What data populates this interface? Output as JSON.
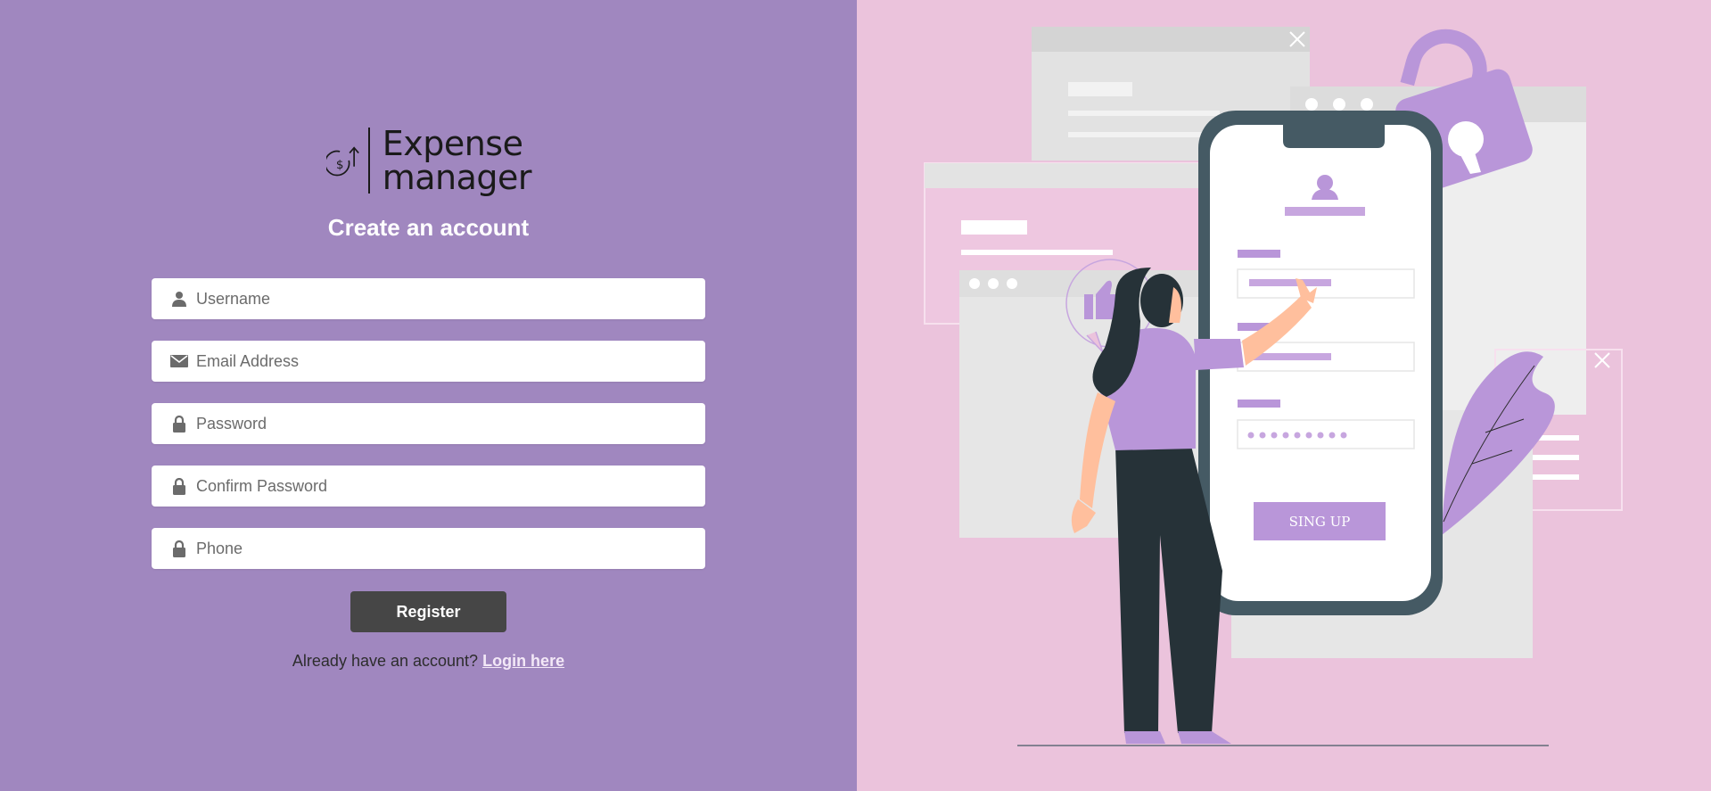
{
  "brand": {
    "line1": "Expense",
    "line2": "manager"
  },
  "form": {
    "title": "Create an account",
    "fields": [
      {
        "placeholder": "Username",
        "icon": "user-icon"
      },
      {
        "placeholder": "Email Address",
        "icon": "envelope-icon"
      },
      {
        "placeholder": "Password",
        "icon": "lock-icon"
      },
      {
        "placeholder": "Confirm Password",
        "icon": "lock-icon"
      },
      {
        "placeholder": "Phone",
        "icon": "lock-icon"
      }
    ],
    "register_label": "Register",
    "login_prompt": "Already have an account?",
    "login_link": "Login here"
  },
  "illustration": {
    "phone_button_label": "SING UP"
  },
  "colors": {
    "left_bg": "#a087bf",
    "right_bg": "#ebc3dc",
    "accent_purple": "#b996d9",
    "button_dark": "#464646",
    "phone_frame": "#455a64"
  }
}
